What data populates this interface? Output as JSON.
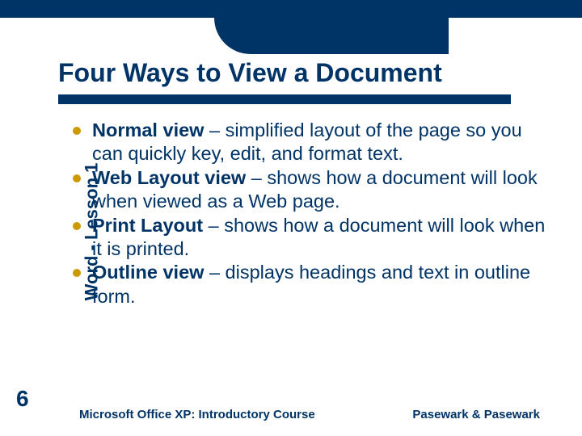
{
  "title": "Four Ways to View a Document",
  "sidebar_label": "Word - Lesson 1",
  "page_number": "6",
  "bullets": [
    {
      "bold": "Normal view",
      "rest": " – simplified layout of the page so you can quickly key, edit, and format text."
    },
    {
      "bold": "Web Layout view",
      "rest": " – shows how a document will look when viewed as a Web page."
    },
    {
      "bold": "Print Layout",
      "rest": " – shows how a document will look when it is printed."
    },
    {
      "bold": "Outline view",
      "rest": " – displays headings and text in outline form."
    }
  ],
  "footer": {
    "left": "Microsoft Office XP:  Introductory Course",
    "right": "Pasewark & Pasewark"
  }
}
